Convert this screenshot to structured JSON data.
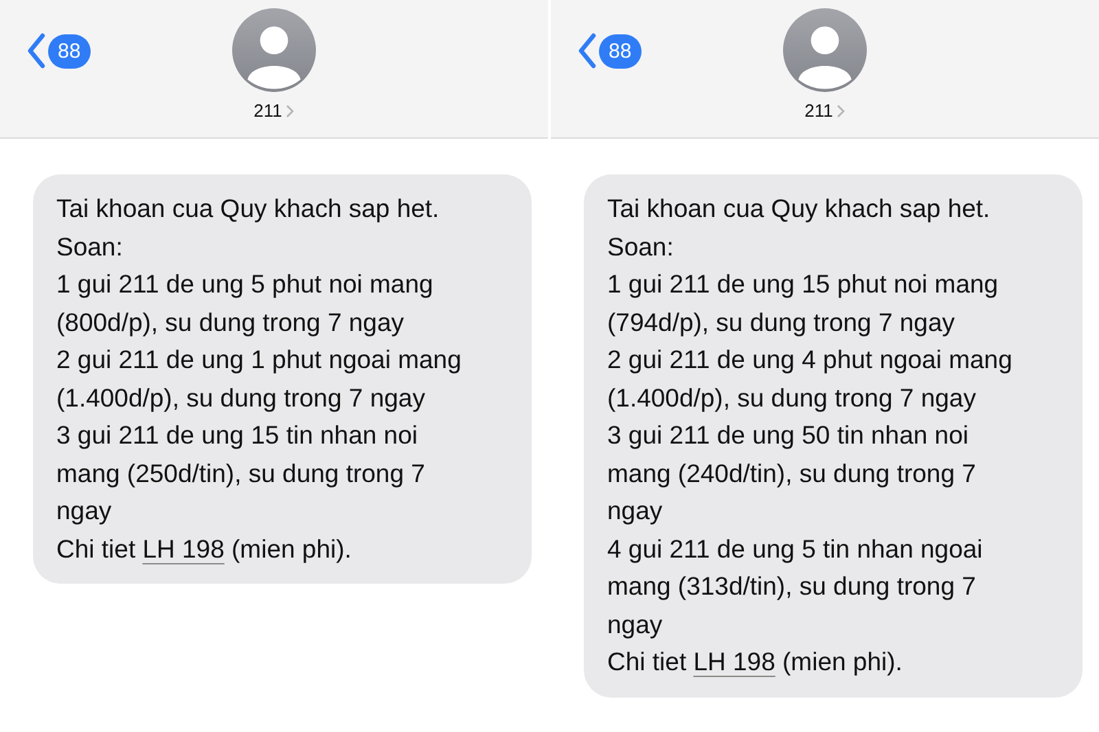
{
  "panels": [
    {
      "back_badge": "88",
      "contact": "211",
      "lines": [
        "Tai khoan cua Quy khach sap het.",
        "Soan:",
        "1 gui 211 de ung 5 phut noi mang",
        "(800d/p), su dung trong 7 ngay",
        "2 gui 211 de ung 1 phut ngoai mang",
        "(1.400d/p), su dung trong 7 ngay",
        "3 gui 211 de ung 15 tin nhan noi",
        "mang (250d/tin), su dung trong 7",
        "ngay"
      ],
      "closing": {
        "before": "Chi tiet",
        "link": "LH 198",
        "after": "(mien phi)."
      }
    },
    {
      "back_badge": "88",
      "contact": "211",
      "lines": [
        "Tai khoan cua Quy khach sap het.",
        "Soan:",
        "1 gui 211 de ung 15 phut noi mang",
        "(794d/p), su dung trong 7 ngay",
        "2 gui 211 de ung 4 phut ngoai mang",
        "(1.400d/p), su dung trong 7 ngay",
        "3 gui 211 de ung 50 tin nhan noi",
        "mang (240d/tin), su dung trong 7",
        "ngay",
        "4 gui 211 de ung 5 tin nhan ngoai",
        "mang (313d/tin), su dung trong 7",
        "ngay"
      ],
      "closing": {
        "before": "Chi tiet",
        "link": "LH 198",
        "after": "(mien phi)."
      }
    }
  ]
}
